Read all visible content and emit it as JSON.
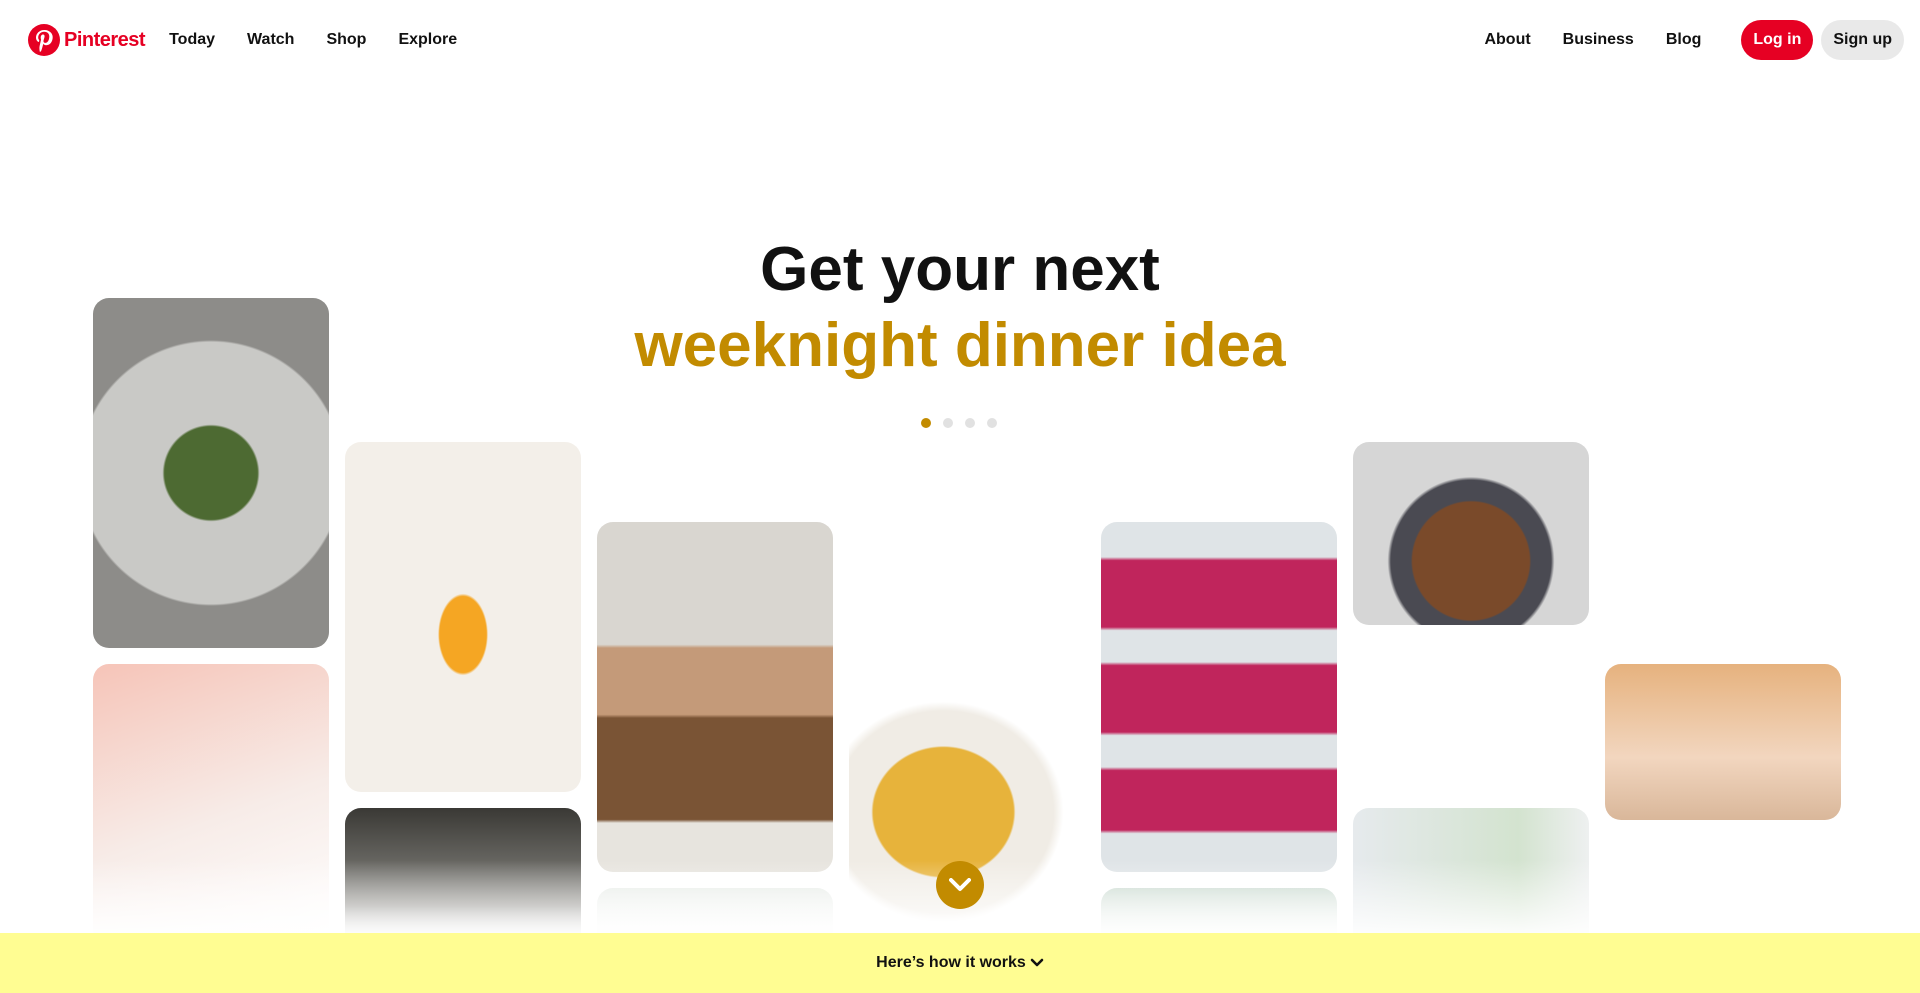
{
  "header": {
    "brand": "Pinterest",
    "nav_left": [
      "Today",
      "Watch",
      "Shop",
      "Explore"
    ],
    "nav_right": [
      "About",
      "Business",
      "Blog"
    ],
    "login_label": "Log in",
    "signup_label": "Sign up"
  },
  "hero": {
    "line1": "Get your next",
    "line2": "weeknight dinner idea",
    "carousel_total": 4,
    "carousel_active": 1
  },
  "pins": [
    {
      "name": "beet-salad-plate",
      "color": "#8d8c89"
    },
    {
      "name": "pink-lemonade-drink",
      "color": "#f2d6cf"
    },
    {
      "name": "orange-juice-glass",
      "color": "#f1e7d8"
    },
    {
      "name": "skillet-pan",
      "color": "#4b4a46"
    },
    {
      "name": "salad-bowl-cooking",
      "color": "#a98b6d"
    },
    {
      "name": "curry-bowl",
      "color": "#e4b850"
    },
    {
      "name": "beet-avocado-toast",
      "color": "#c74a78"
    },
    {
      "name": "roast-dinner-plate",
      "color": "#8b6a52"
    },
    {
      "name": "green-dish",
      "color": "#d5dcd3"
    },
    {
      "name": "cafe-interior",
      "color": "#e0b494"
    }
  ],
  "footer": {
    "how_it_works": "Here’s how it works"
  },
  "colors": {
    "brand_red": "#e60023",
    "accent_gold": "#c28b00",
    "banner_yellow": "#fffd92"
  }
}
